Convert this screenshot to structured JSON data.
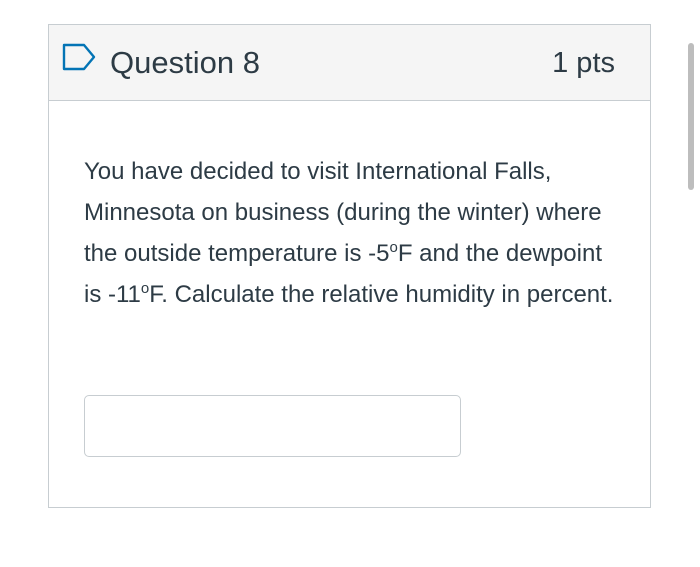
{
  "question": {
    "title": "Question 8",
    "points": "1 pts",
    "flag_icon": "flag-outline-icon",
    "text_parts": {
      "p1": "You have decided to visit International Falls, Minnesota on business (during the winter) where the outside temperature  is -5",
      "sup1": "o",
      "p2": "F and the dewpoint is -11",
      "sup2": "o",
      "p3": "F. Calculate the relative humidity in percent."
    },
    "answer": {
      "value": "",
      "placeholder": ""
    }
  },
  "colors": {
    "header_bg": "#f5f5f5",
    "border": "#c7cdd1",
    "text": "#2d3b45",
    "flag": "#0374b5"
  }
}
